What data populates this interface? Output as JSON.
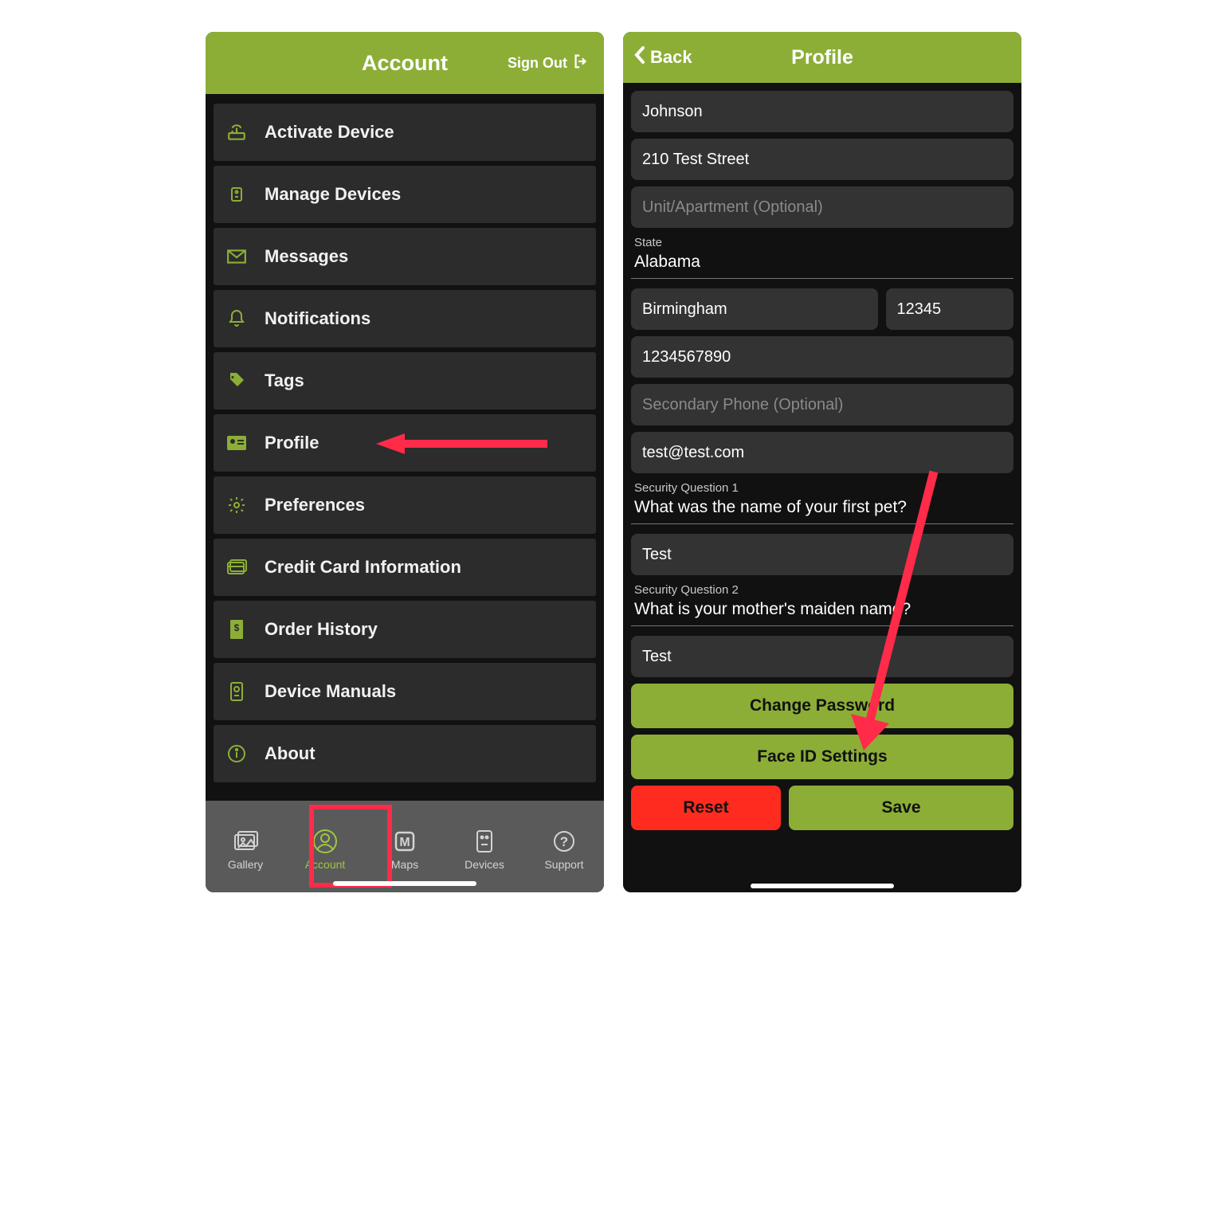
{
  "left": {
    "header_title": "Account",
    "sign_out": "Sign Out",
    "menu": [
      {
        "id": "activate-device",
        "label": "Activate Device"
      },
      {
        "id": "manage-devices",
        "label": "Manage Devices"
      },
      {
        "id": "messages",
        "label": "Messages"
      },
      {
        "id": "notifications",
        "label": "Notifications"
      },
      {
        "id": "tags",
        "label": "Tags"
      },
      {
        "id": "profile",
        "label": "Profile"
      },
      {
        "id": "preferences",
        "label": "Preferences"
      },
      {
        "id": "credit-card",
        "label": "Credit Card Information"
      },
      {
        "id": "order-history",
        "label": "Order History"
      },
      {
        "id": "device-manuals",
        "label": "Device Manuals"
      },
      {
        "id": "about",
        "label": "About"
      }
    ],
    "nav": {
      "gallery": "Gallery",
      "account": "Account",
      "maps": "Maps",
      "devices": "Devices",
      "support": "Support"
    }
  },
  "right": {
    "back": "Back",
    "title": "Profile",
    "last_name": "Johnson",
    "street": "210 Test Street",
    "unit_placeholder": "Unit/Apartment (Optional)",
    "state_label": "State",
    "state_value": "Alabama",
    "city": "Birmingham",
    "zip": "12345",
    "phone": "1234567890",
    "secondary_placeholder": "Secondary Phone (Optional)",
    "email": "test@test.com",
    "sq1_label": "Security Question 1",
    "sq1_value": "What was the name of your first pet?",
    "sq1_answer": "Test",
    "sq2_label": "Security Question 2",
    "sq2_value": "What is your mother's maiden name?",
    "sq2_answer": "Test",
    "change_pw": "Change Password",
    "faceid": "Face ID Settings",
    "reset": "Reset",
    "save": "Save"
  },
  "colors": {
    "accent": "#8cae36",
    "danger": "#ff2b1e",
    "annotation": "#ff2b49"
  }
}
